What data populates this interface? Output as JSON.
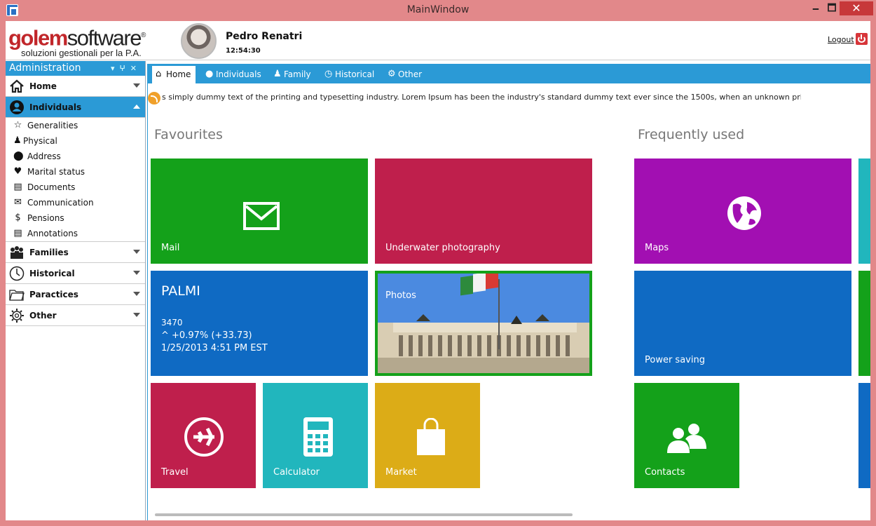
{
  "window": {
    "title": "MainWindow",
    "min_label": "🗕",
    "max_label": "🗖",
    "close_label": "✕"
  },
  "header": {
    "brand_part1": "golem",
    "brand_part2": "software",
    "brand_mark": "®",
    "tagline": "soluzioni gestionali per la P.A.",
    "user_name": "Pedro Renatri",
    "time": "12:54:30",
    "logout_label": "Logout"
  },
  "panel": {
    "title": "Administration",
    "sections": [
      {
        "label": "Home",
        "icon": "home-icon"
      },
      {
        "label": "Individuals",
        "icon": "person-icon",
        "active": true
      },
      {
        "label": "Families",
        "icon": "family-icon"
      },
      {
        "label": "Historical",
        "icon": "clock-icon"
      },
      {
        "label": "Paractices",
        "icon": "folder-icon"
      },
      {
        "label": "Other",
        "icon": "gear-icon"
      }
    ],
    "individuals_items": [
      {
        "label": "Generalities",
        "icon": "star-icon"
      },
      {
        "label": "Physical",
        "icon": "person-small-icon"
      },
      {
        "label": "Address",
        "icon": "map-pin-icon"
      },
      {
        "label": "Marital status",
        "icon": "heart-icon"
      },
      {
        "label": "Documents",
        "icon": "document-icon"
      },
      {
        "label": "Communication",
        "icon": "envelope-icon"
      },
      {
        "label": "Pensions",
        "icon": "dollar-icon"
      },
      {
        "label": "Annotations",
        "icon": "note-icon"
      }
    ]
  },
  "tabs": [
    {
      "label": "Home",
      "icon": "home-icon",
      "active": true
    },
    {
      "label": "Individuals",
      "icon": "person-icon"
    },
    {
      "label": "Family",
      "icon": "family-icon"
    },
    {
      "label": "Historical",
      "icon": "history-icon"
    },
    {
      "label": "Other",
      "icon": "other-icon"
    }
  ],
  "ticker": {
    "text": "s simply dummy text of the printing and typesetting industry. Lorem Ipsum has been the industry's standard dummy text ever since the 1500s, when an unknown printer took a galley of type"
  },
  "groups": {
    "favourites": "Favourites",
    "frequent": "Frequently used"
  },
  "tiles": {
    "mail": {
      "label": "Mail",
      "color": "#14a11a"
    },
    "underwater": {
      "label": "Underwater photography",
      "color": "#bf1f4c"
    },
    "palmi": {
      "title": "PALMI",
      "line1": "3470",
      "line2": "^   +0.97% (+33.73)",
      "line3": "1/25/2013 4:51 PM EST",
      "color": "#0f6ac3"
    },
    "photos": {
      "label": "Photos"
    },
    "travel": {
      "label": "Travel",
      "color": "#bf1f4c"
    },
    "calculator": {
      "label": "Calculator",
      "color": "#21b6bd"
    },
    "market": {
      "label": "Market",
      "color": "#dcac17"
    },
    "maps": {
      "label": "Maps",
      "color": "#a20fb2"
    },
    "power": {
      "label": "Power saving",
      "color": "#0f6ac3"
    },
    "contacts": {
      "label": "Contacts",
      "color": "#14a11a"
    }
  }
}
